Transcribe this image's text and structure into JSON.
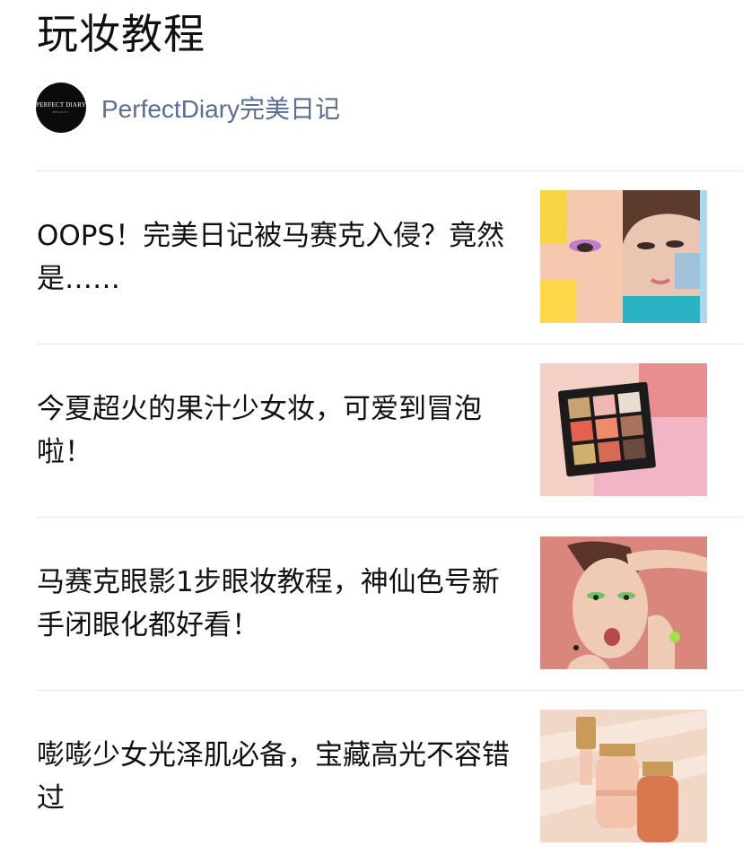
{
  "page": {
    "title": "玩妆教程"
  },
  "account": {
    "avatar_text": "PERFECT DIARY",
    "avatar_sub": "BEAUTY",
    "name": "PerfectDiary完美日记"
  },
  "articles": [
    {
      "title": "OOPS！完美日记被马赛克入侵？竟然是……",
      "thumb": "mosaic-faces-image"
    },
    {
      "title": "今夏超火的果汁少女妆，可爱到冒泡啦！",
      "thumb": "eyeshadow-palette-image"
    },
    {
      "title": "马赛克眼影1步眼妆教程，神仙色号新手闭眼化都好看！",
      "thumb": "model-portrait-image"
    },
    {
      "title": "嘭嘭少女光泽肌必备，宝藏高光不容错过",
      "thumb": "highlighter-bottles-image"
    }
  ]
}
